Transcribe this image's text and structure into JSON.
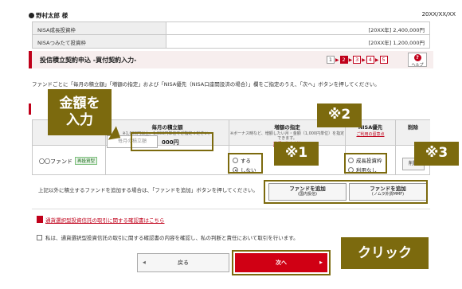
{
  "header": {
    "user": "野村太郎 様",
    "date": "20XX/XX/XX"
  },
  "nisa": [
    {
      "label": "NISA成長投資枠",
      "value": "[20XX年] 2,400,000円"
    },
    {
      "label": "NISAつみたて投資枠",
      "value": "[20XX年] 1,200,000円"
    }
  ],
  "title": "投信積立契約申込 -買付契約入力-",
  "steps": [
    "1",
    "2",
    "3",
    "4",
    "5"
  ],
  "help": {
    "label": "ヘルプ"
  },
  "intro": "ファンドごとに「毎月の積立額」「増額の指定」および「NISA優先（NISA口座開設済の場合）」欄をご指定のうえ、「次へ」ボタンを押してください。",
  "table": {
    "col_amount": "毎月の積立額",
    "col_amount_note": "※1,000円以上、1,000円単位でご指定ください。",
    "col_increase": "増額の指定",
    "col_increase_note": "※ボーナス時など、増額したい月・金額（1,000円単位）を指定できます。",
    "col_increase_link": "増額の指定方法",
    "col_nisa": "NISA優先",
    "col_nisa_link": "ご利用の留意点",
    "col_delete": "削除",
    "fund_name": "〇〇ファンド",
    "fund_badge": "再投資型",
    "amount_placeholder": "毎月の積立額",
    "amount_unit": "000円",
    "increase_options": [
      "する",
      "しない"
    ],
    "nisa_options": [
      "成長投資枠",
      "利用なし"
    ],
    "delete_label": "削除"
  },
  "add": {
    "text": "上記以外に積立するファンドを追加する場合は、「ファンドを追加」ボタンを押してください。",
    "btn1": "ファンドを追加",
    "btn1_sub": "(国内投信)",
    "btn2": "ファンドを追加",
    "btn2_sub": "(ノムラ外貨MMF)"
  },
  "doc_link": "通貨選択型投資信託の取引に関する確認書はこちら",
  "confirm": "私は、通貨選択型投資信託の取引に関する確認書の内容を確認し、私の判断と責任において取引を行います。",
  "buttons": {
    "back": "戻る",
    "next": "次へ"
  },
  "annotations": {
    "amount_line1": "金額を",
    "amount_line2": "入力",
    "mark1": "※1",
    "mark2": "※2",
    "mark3": "※3",
    "click": "クリック"
  },
  "colors": {
    "accent": "#c0001a",
    "annotation": "#7c6a0e"
  }
}
